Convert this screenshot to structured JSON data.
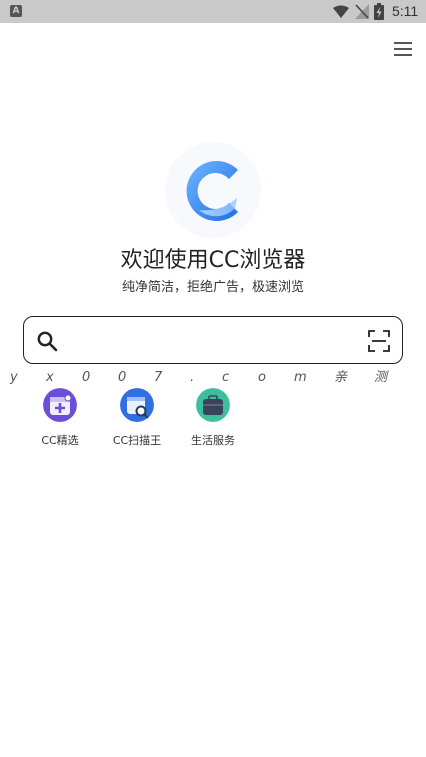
{
  "status_bar": {
    "notification_icon": "A",
    "time": "5:11"
  },
  "header": {
    "menu_icon": "hamburger-menu-icon"
  },
  "hero": {
    "logo_icon": "cc-browser-logo",
    "title": "欢迎使用CC浏览器",
    "subtitle": "纯净简洁，拒绝广告，极速浏览"
  },
  "search": {
    "value": "",
    "placeholder": "",
    "search_icon": "search-icon",
    "scan_icon": "scan-icon"
  },
  "watermark": [
    "y",
    "x",
    "0",
    "0",
    "7",
    ".",
    "c",
    "o",
    "m",
    "亲",
    "测"
  ],
  "shortcuts": [
    {
      "label": "CC精选",
      "icon": "cc-featured-icon",
      "color": "#6c4fd8"
    },
    {
      "label": "CC扫描王",
      "icon": "cc-scanner-icon",
      "color": "#2f6fe0"
    },
    {
      "label": "生活服务",
      "icon": "life-services-icon",
      "color": "#3b4358"
    }
  ],
  "colors": {
    "status_bar": "#c9c9c9",
    "logo_blue": "#3a8ef0",
    "text": "#222222"
  }
}
